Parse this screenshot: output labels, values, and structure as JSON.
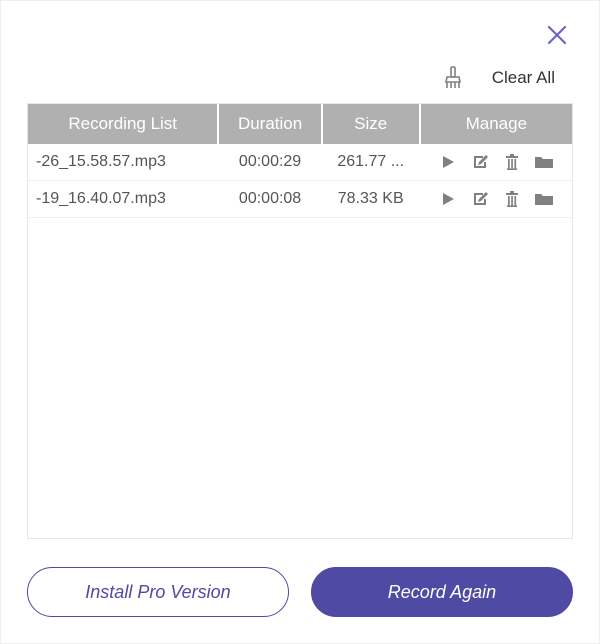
{
  "colors": {
    "accent": "#4f4aa3",
    "header_bg": "#b0b0b0",
    "icon_grey": "#808080"
  },
  "toolbar": {
    "clear_all_label": "Clear All"
  },
  "columns": {
    "name": "Recording List",
    "duration": "Duration",
    "size": "Size",
    "manage": "Manage"
  },
  "rows": [
    {
      "name": "-26_15.58.57.mp3",
      "duration": "00:00:29",
      "size": "261.77 ..."
    },
    {
      "name": "-19_16.40.07.mp3",
      "duration": "00:00:08",
      "size": "78.33 KB"
    }
  ],
  "footer": {
    "install_label": "Install Pro Version",
    "record_label": "Record Again"
  }
}
